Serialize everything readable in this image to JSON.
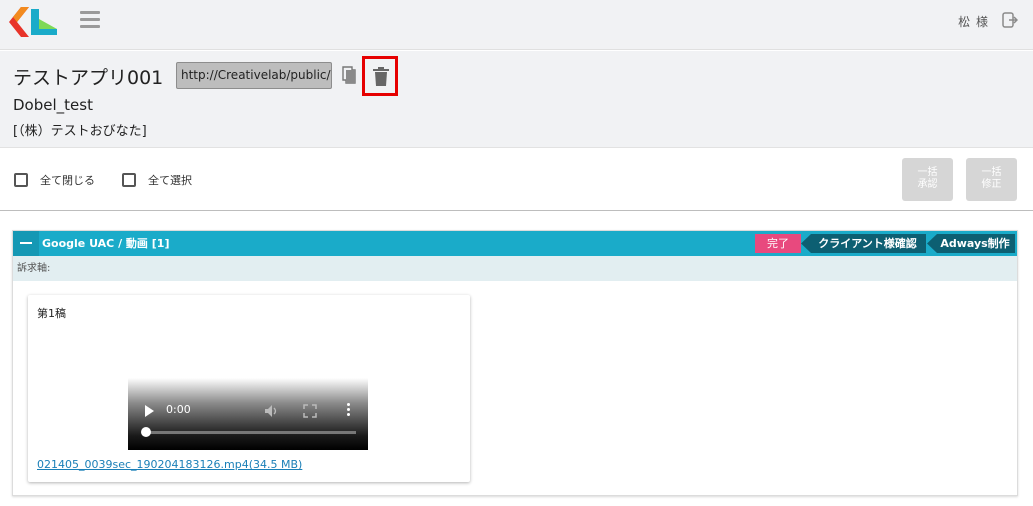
{
  "header": {
    "user_name": "松 様",
    "icons": {
      "logo": "logo-icon",
      "menu": "hamburger-icon",
      "logout": "logout-icon"
    }
  },
  "app": {
    "title": "テストアプリ001",
    "url": "http://Creativelab/public/",
    "client": "Dobel_test",
    "company": "[（株）テストおびなた]",
    "icons": {
      "copy": "copy-icon",
      "delete": "trash-icon"
    },
    "highlight_color": "#e60000"
  },
  "toolbar": {
    "collapse_all": "全て閉じる",
    "select_all": "全て選択",
    "bulk_approve": [
      "一括",
      "承認"
    ],
    "bulk_fix": [
      "一括",
      "修正"
    ]
  },
  "section": {
    "title": "Google UAC / 動画 [1]",
    "statuses": [
      "完了",
      "クライアント様確認",
      "Adways制作"
    ],
    "appeal_label": "訴求軸:",
    "colors": {
      "header": "#1aabc9",
      "done": "#e8497e",
      "step": "#0d5f72"
    }
  },
  "draft": {
    "label": "第1稿",
    "video_time": "0:00",
    "file_link": "021405_0039sec_190204183126.mp4(34.5 MB)"
  }
}
